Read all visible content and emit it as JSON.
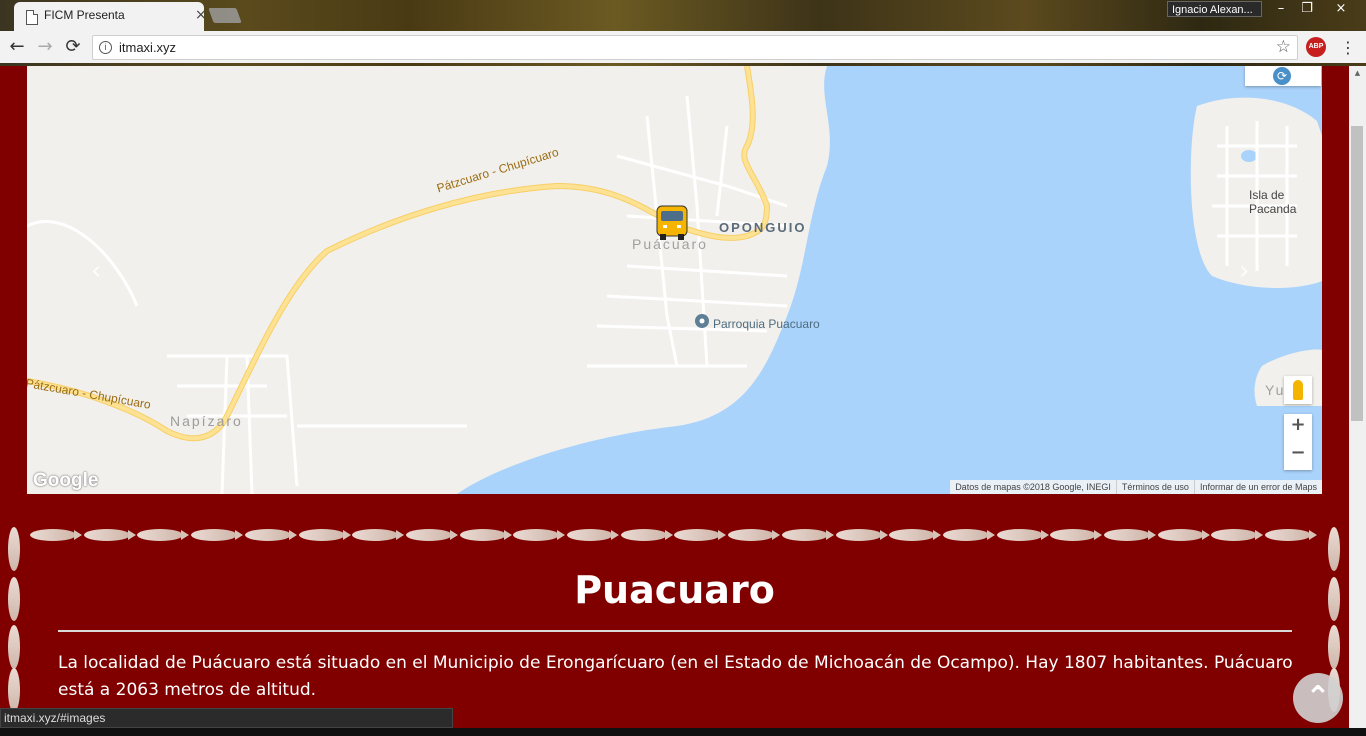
{
  "browser": {
    "tab_title": "FICM Presenta",
    "tab_close": "×",
    "user_name": "Ignacio Alexan...",
    "window_min": "–",
    "window_restore": "❐",
    "window_close": "×",
    "back": "←",
    "forward": "→",
    "reload": "⟳",
    "url": "itmaxi.xyz",
    "info_icon": "i",
    "bookmark_star": "☆",
    "adblock_label": "ABP",
    "menu": "⋮",
    "status_url": "itmaxi.xyz/#images"
  },
  "map": {
    "labels": {
      "road_1": "Pátzcuaro - Chupícuaro",
      "road_2": "Pátzcuaro - Chupícuaro",
      "oponguio": "OPONGUIO",
      "puacuaro": "Puácuaro",
      "parroquia": "Parroquia Puacuaro",
      "napizaro": "Napízaro",
      "isla": "Isla de",
      "isla_2": "Pacanda",
      "yunuen": "Yunué"
    },
    "google_logo": "Google",
    "attribution": {
      "data": "Datos de mapas ©2018 Google, INEGI",
      "terms": "Términos de uso",
      "report": "Informar de un error de Maps"
    },
    "zoom_in": "+",
    "zoom_out": "−",
    "refresh_icon": "⟳",
    "prev_arrow": "‹",
    "next_arrow": "›",
    "colors": {
      "water": "#aad3fb",
      "land": "#f2f0ec",
      "road": "#fde293",
      "street": "#ffffff"
    }
  },
  "content": {
    "title": "Puacuaro",
    "description": "La localidad de Puácuaro está situado en el Municipio de Erongarícuaro (en el Estado de Michoacán de Ocampo). Hay 1807 habitantes. Puácuaro está a 2063 metros de altitud."
  },
  "back_to_top": "⌃",
  "colors": {
    "page_background": "#800000",
    "text": "#ffffff"
  }
}
